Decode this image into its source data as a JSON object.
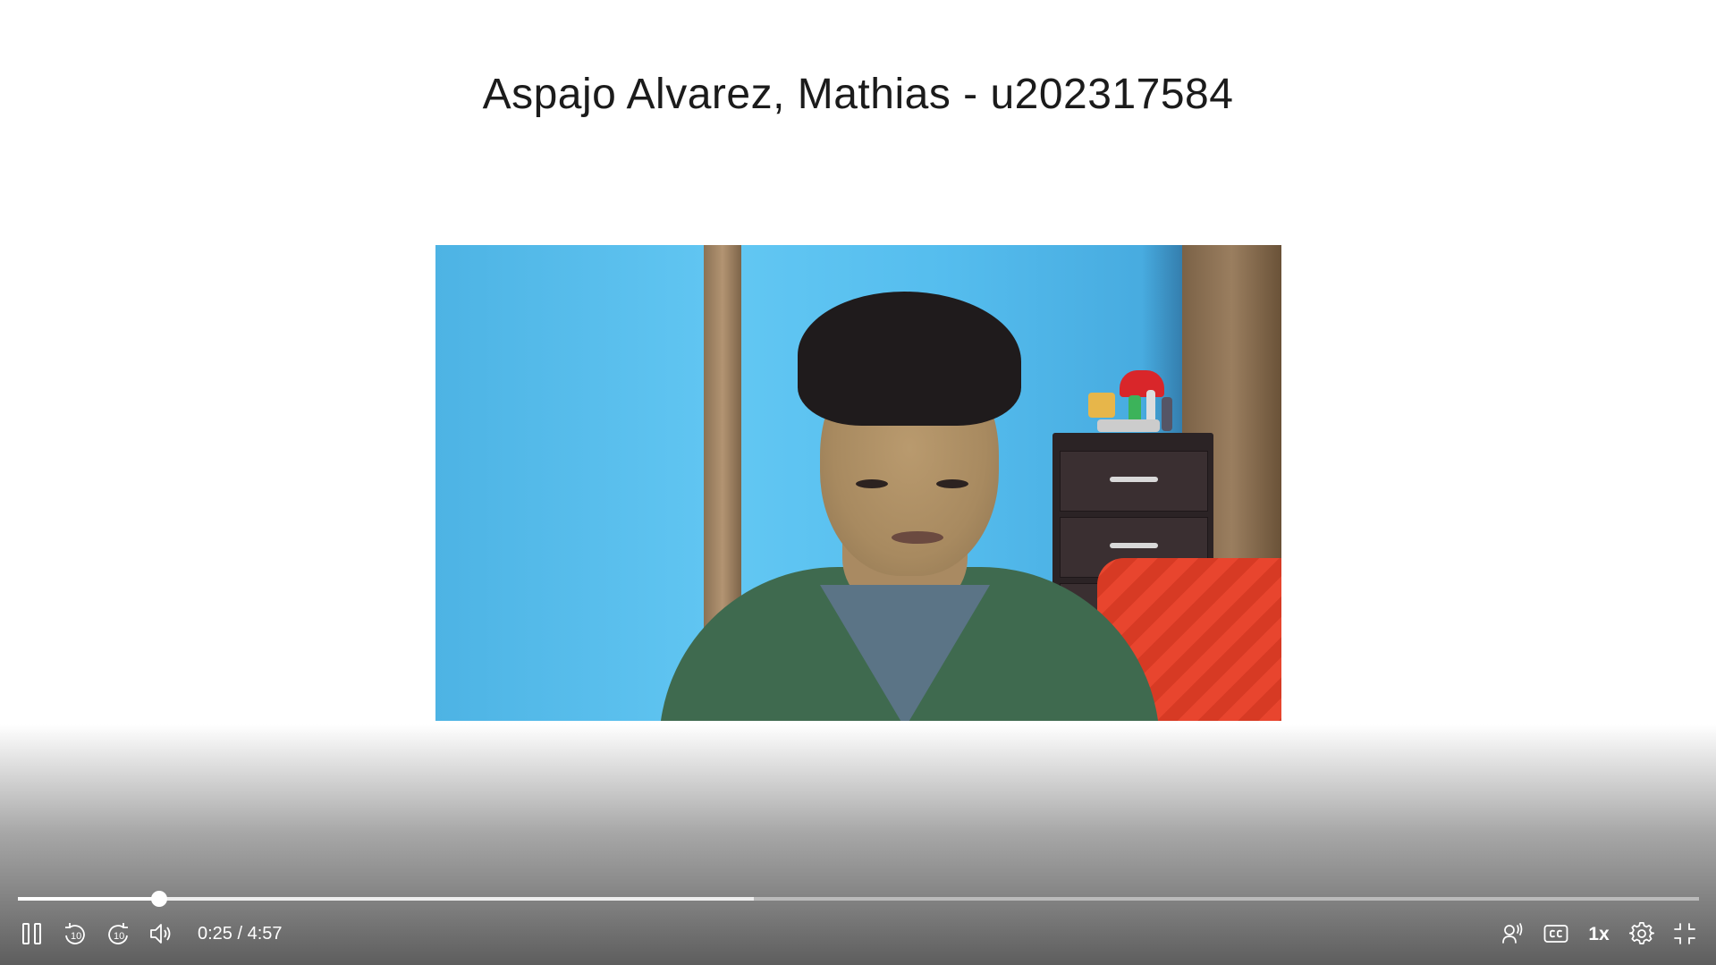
{
  "slide": {
    "title": "Aspajo Alvarez, Mathias - u202317584"
  },
  "player": {
    "time_current": "0:25",
    "time_separator": "/",
    "time_total": "4:57",
    "progress_fraction": 0.0842,
    "buffered_fraction": 0.4375,
    "speed_label": "1x",
    "rewind_seconds": "10",
    "forward_seconds": "10",
    "icons": {
      "pause": "pause-icon",
      "rewind": "rewind-10-icon",
      "forward": "forward-10-icon",
      "volume": "volume-icon",
      "audio_description": "audio-description-icon",
      "captions": "closed-captions-icon",
      "settings": "gear-icon",
      "fullscreen": "exit-fullscreen-icon"
    },
    "colors": {
      "control_foreground": "#ffffff",
      "played": "#ffffff",
      "background": "#ffffff"
    }
  }
}
